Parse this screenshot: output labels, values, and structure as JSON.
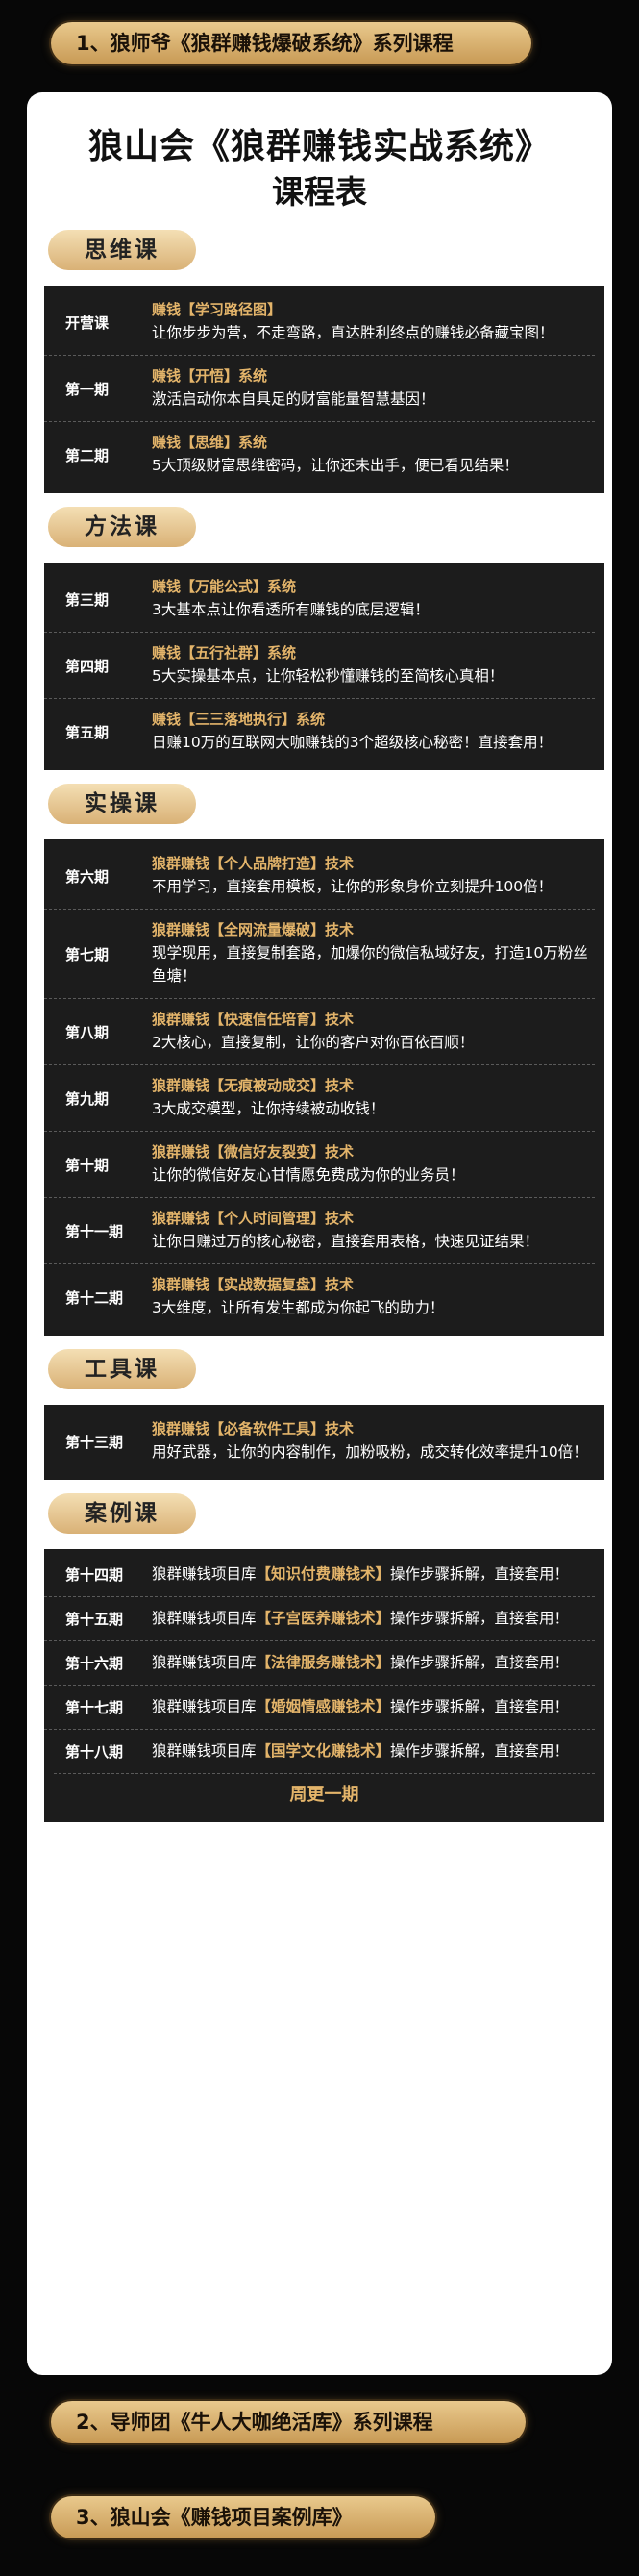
{
  "pills": [
    "1、狼师爷《狼群赚钱爆破系统》系列课程",
    "2、导师团《牛人大咖绝活库》系列课程",
    "3、狼山会《赚钱项目案例库》"
  ],
  "card": {
    "title": "狼山会《狼群赚钱实战系统》",
    "subtitle": "课程表"
  },
  "sections": {
    "thinking": {
      "label": "思维课",
      "rows": [
        {
          "period": "开营课",
          "title": "赚钱【学习路径图】",
          "desc": "让你步步为营，不走弯路，直达胜利终点的赚钱必备藏宝图！"
        },
        {
          "period": "第一期",
          "title": "赚钱【开悟】系统",
          "desc": "激活启动你本自具足的财富能量智慧基因！"
        },
        {
          "period": "第二期",
          "title": "赚钱【思维】系统",
          "desc": "5大顶级财富思维密码，让你还未出手，便已看见结果！"
        }
      ]
    },
    "method": {
      "label": "方法课",
      "rows": [
        {
          "period": "第三期",
          "title": "赚钱【万能公式】系统",
          "desc": "3大基本点让你看透所有赚钱的底层逻辑！"
        },
        {
          "period": "第四期",
          "title": "赚钱【五行社群】系统",
          "desc": "5大实操基本点，让你轻松秒懂赚钱的至简核心真相！"
        },
        {
          "period": "第五期",
          "title": "赚钱【三三落地执行】系统",
          "desc": "日赚10万的互联网大咖赚钱的3个超级核心秘密！直接套用！"
        }
      ]
    },
    "practice": {
      "label": "实操课",
      "rows": [
        {
          "period": "第六期",
          "title": "狼群赚钱【个人品牌打造】技术",
          "desc": "不用学习，直接套用模板，让你的形象身价立刻提升100倍！"
        },
        {
          "period": "第七期",
          "title": "狼群赚钱【全网流量爆破】技术",
          "desc": "现学现用，直接复制套路，加爆你的微信私域好友，打造10万粉丝鱼塘！"
        },
        {
          "period": "第八期",
          "title": "狼群赚钱【快速信任培育】技术",
          "desc": "2大核心，直接复制，让你的客户对你百依百顺！"
        },
        {
          "period": "第九期",
          "title": "狼群赚钱【无痕被动成交】技术",
          "desc": "3大成交模型，让你持续被动收钱！"
        },
        {
          "period": "第十期",
          "title": "狼群赚钱【微信好友裂变】技术",
          "desc": "让你的微信好友心甘情愿免费成为你的业务员！"
        },
        {
          "period": "第十一期",
          "title": "狼群赚钱【个人时间管理】技术",
          "desc": "让你日赚过万的核心秘密，直接套用表格，快速见证结果！"
        },
        {
          "period": "第十二期",
          "title": "狼群赚钱【实战数据复盘】技术",
          "desc": "3大维度，让所有发生都成为你起飞的助力！"
        }
      ]
    },
    "tools": {
      "label": "工具课",
      "rows": [
        {
          "period": "第十三期",
          "title": "狼群赚钱【必备软件工具】技术",
          "desc": "用好武器，让你的内容制作，加粉吸粉，成交转化效率提升10倍！"
        }
      ]
    },
    "cases": {
      "label": "案例课",
      "prefix": "狼群赚钱项目库",
      "suffix": "操作步骤拆解，直接套用！",
      "rows": [
        {
          "period": "第十四期",
          "highlight": "【知识付费赚钱术】"
        },
        {
          "period": "第十五期",
          "highlight": "【子宫医养赚钱术】"
        },
        {
          "period": "第十六期",
          "highlight": "【法律服务赚钱术】"
        },
        {
          "period": "第十七期",
          "highlight": "【婚姻情感赚钱术】"
        },
        {
          "period": "第十八期",
          "highlight": "【国学文化赚钱术】"
        }
      ],
      "footer": "周更一期"
    }
  }
}
